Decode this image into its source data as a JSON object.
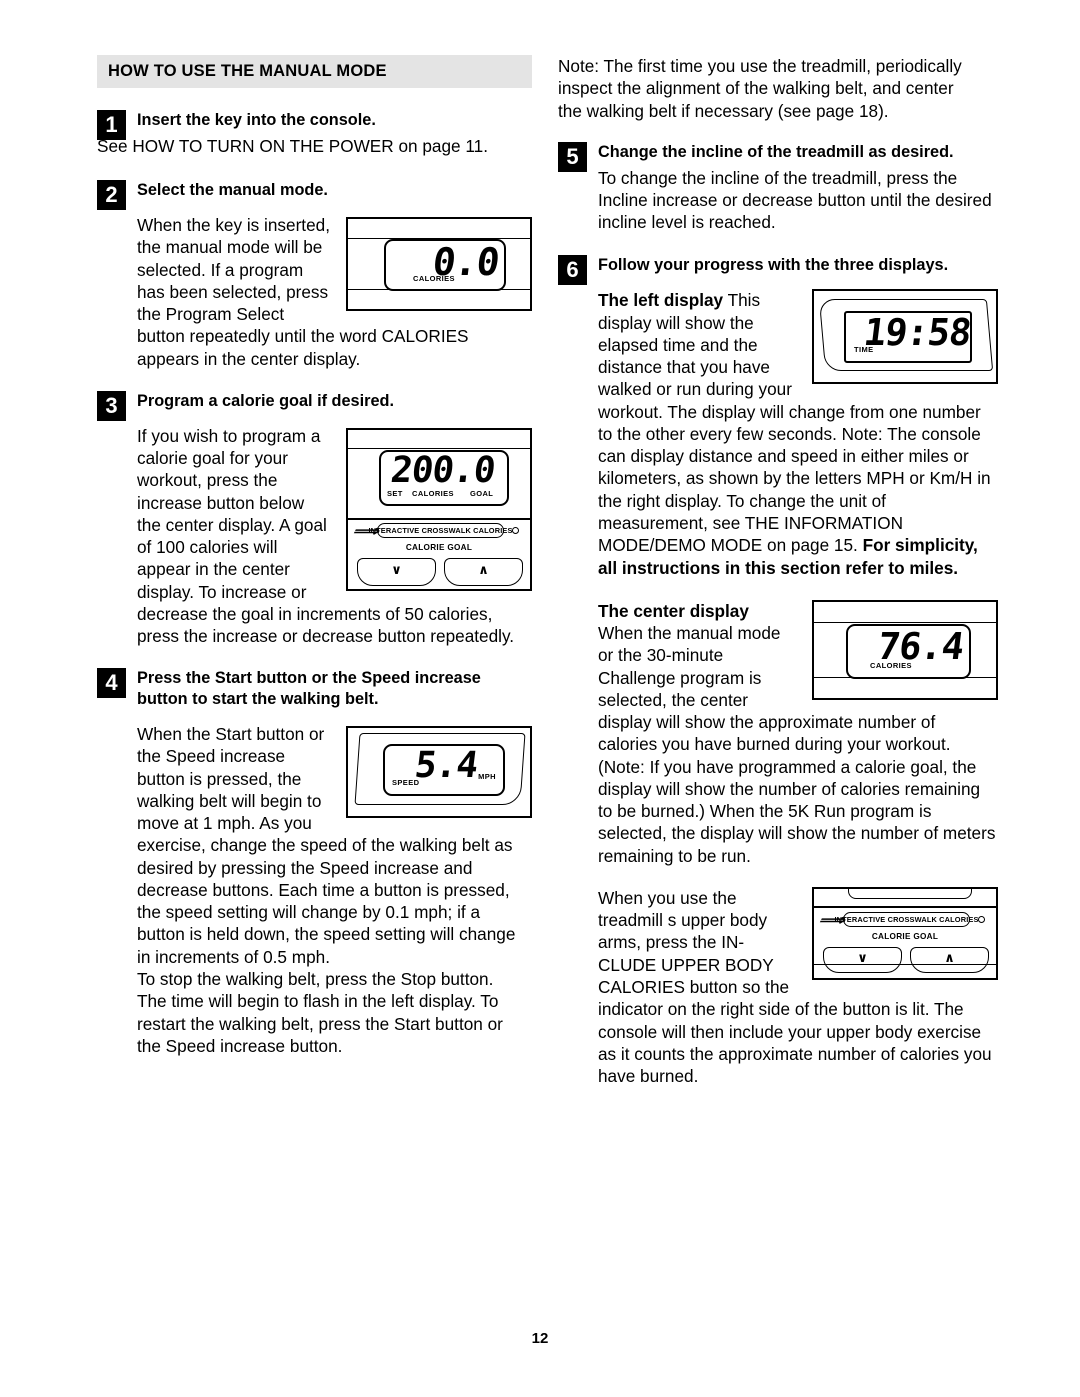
{
  "document": {
    "page_number": "12",
    "section_heading": "HOW TO USE THE MANUAL MODE"
  },
  "left_column": {
    "step1": {
      "number": "1",
      "title": "Insert the key into the console.",
      "body": "See HOW TO TURN ON THE POWER on page 11."
    },
    "step2": {
      "number": "2",
      "title": "Select the manual mode.",
      "body_wrap": "When the key is inserted, the manual mode will be selected. If a program has been selected, press the Program Select button repeatedly until the word CALORIES appears in the center display.",
      "figure": {
        "name": "calories-zero-display",
        "digits": "0.0",
        "label": "CALORIES"
      }
    },
    "step3": {
      "number": "3",
      "title": "Program a calorie goal if desired.",
      "body_wrap": "If you wish to program a calorie goal for your workout, press the increase button below the center display. A goal of 100 calories will appear in the center display. To increase or decrease the goal in increments of 50 calories, press the increase or decrease button repeatedly.",
      "figure": {
        "name": "calorie-goal-display",
        "digits": "200.0",
        "label_set": "SET",
        "label_calories": "CALORIES",
        "label_goal": "GOAL",
        "pill_text": "INTERACTIVE CROSSWALK CALORIES",
        "panel_label": "CALORIE GOAL",
        "btn_decrease": "∨",
        "btn_increase": "∧"
      }
    },
    "step4": {
      "number": "4",
      "title": "Press the Start button or the Speed increase button to start the walking belt.",
      "body_wrap": "When the Start button or the Speed increase button is pressed, the walking belt will begin to move at 1 mph. As you exercise, change the speed of the walking belt as desired by pressing the Speed increase and decrease buttons. Each time a button is pressed, the speed setting will change by 0.1 mph; if a button is held down, the speed setting will change in increments of 0.5 mph.",
      "body_after": "To stop the walking belt, press the Stop button. The time will begin to flash in the left display. To restart the walking belt, press the Start button or the Speed increase button.",
      "figure": {
        "name": "speed-display",
        "digits": "5.4",
        "label_speed": "SPEED",
        "label_unit": "MPH"
      }
    }
  },
  "right_column": {
    "note_top": "Note: The first time you use the treadmill, periodically inspect the alignment of the walking belt, and center the walking belt if necessary (see page 18).",
    "step5": {
      "number": "5",
      "title": "Change the incline of the treadmill as desired.",
      "body": "To change the incline of the treadmill, press the Incline increase or decrease button until the desired incline level is reached."
    },
    "step6": {
      "number": "6",
      "title": "Follow your progress with the three displays.",
      "left_display": {
        "heading": "The left display",
        "body_wrap": " This display will show the elapsed time and the distance that you have walked or run during your workout. The display will change from one number to the other every few seconds. Note: The console can display distance and speed in either miles or kilometers, as shown by the letters MPH or Km/H in the right display. To change the unit of measurement, see THE INFORMATION MODE/DEMO MODE on page 15. ",
        "body_bold_tail": "For simplicity, all instructions in this section refer to miles.",
        "figure": {
          "name": "time-display",
          "digits": "19:58",
          "label": "TIME"
        }
      },
      "center_display": {
        "heading": "The center display",
        "body_wrap": "When the manual mode or the 30-minute Challenge program is selected, the center display will show the approximate number of calories you have burned during your workout. (Note: If you have programmed a calorie goal, the display will show the number of calories remaining to be burned.) When the 5K Run program is selected, the display will show the number of meters remaining to be run.",
        "figure": {
          "name": "center-calories-display",
          "digits": "76.4",
          "label": "CALORIES"
        }
      },
      "upper_body": {
        "body_wrap": "When you use the treadmill s upper body arms, press the IN-CLUDE UPPER BODY CALORIES button so the indicator on the right side of the button is lit. The console will then include your upper body exercise as it counts the approximate number of calories you have burned.",
        "figure": {
          "name": "upper-body-button-panel",
          "pill_text": "INTERACTIVE CROSSWALK CALORIES",
          "panel_label": "CALORIE GOAL",
          "btn_decrease": "∨",
          "btn_increase": "∧"
        }
      }
    }
  }
}
